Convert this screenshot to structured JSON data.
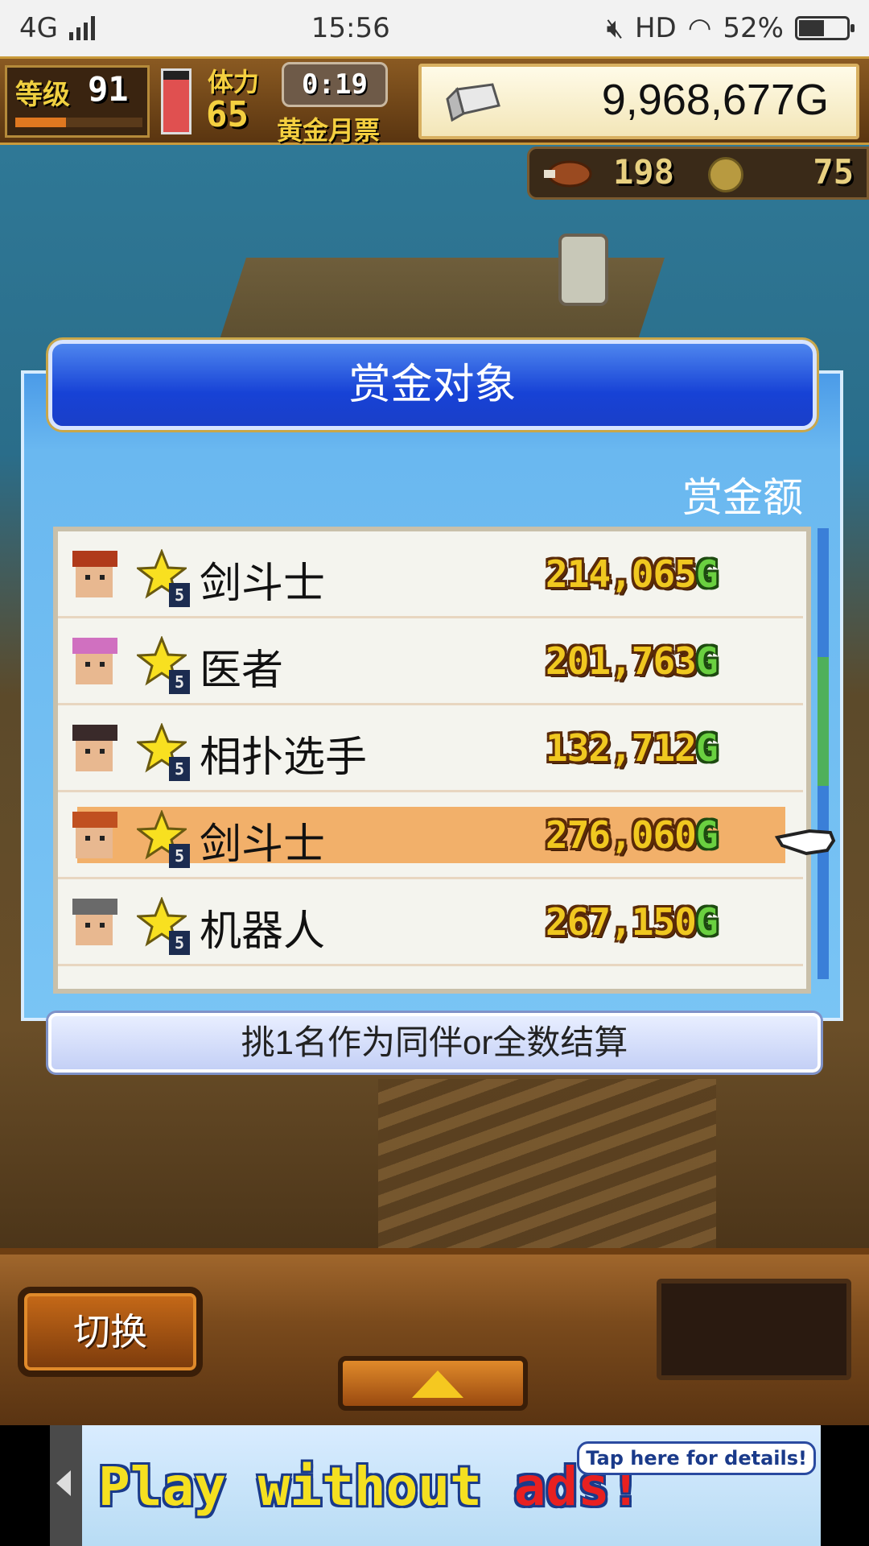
{
  "status_bar": {
    "network": "4G",
    "time": "15:56",
    "hd": "HD",
    "battery": "52%",
    "battery_level": 0.52
  },
  "hud": {
    "level_label": "等级",
    "level_value": "91",
    "level_progress": 0.4,
    "stamina_level": 0.85,
    "stamina_label": "体力",
    "stamina_value": "65",
    "timer": "0:19",
    "pass_label": "黄金月票",
    "gold_value": "9,968,677G",
    "meat_value": "198",
    "coin_value": "75"
  },
  "dialog": {
    "title": "赏金对象",
    "column_header": "赏金额",
    "rows": [
      {
        "name": "剑斗士",
        "rank": "5",
        "bounty": "214,065",
        "unit": "G",
        "selected": false
      },
      {
        "name": "医者",
        "rank": "5",
        "bounty": "201,763",
        "unit": "G",
        "selected": false
      },
      {
        "name": "相扑选手",
        "rank": "5",
        "bounty": "132,712",
        "unit": "G",
        "selected": false
      },
      {
        "name": "剑斗士",
        "rank": "5",
        "bounty": "276,060",
        "unit": "G",
        "selected": true
      },
      {
        "name": "机器人",
        "rank": "5",
        "bounty": "267,150",
        "unit": "G",
        "selected": false
      }
    ],
    "footer": "挑1名作为同伴or全数结算"
  },
  "bottom": {
    "switch_label": "切换"
  },
  "ad": {
    "main_text": "Play without ",
    "accent_text": "ads!",
    "bubble": "Tap here for details!"
  },
  "colors": {
    "dialog_blue": "#1742d6",
    "selected_row": "#f2b06a",
    "bounty_gold": "#f0c820",
    "bounty_unit_green": "#6ad040"
  }
}
